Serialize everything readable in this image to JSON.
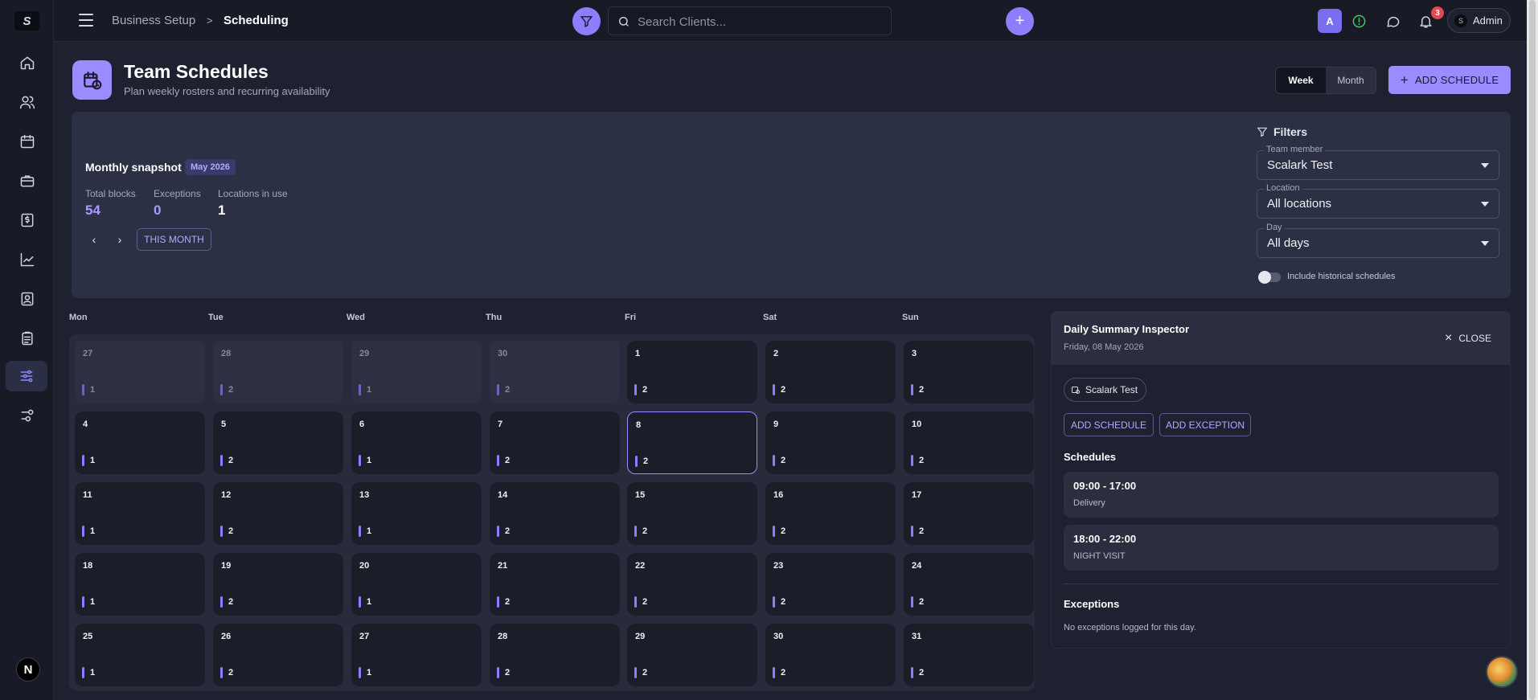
{
  "logo": {
    "text": "S"
  },
  "sidebar": {
    "items": [
      {
        "icon": "home-icon"
      },
      {
        "icon": "users-icon"
      },
      {
        "icon": "calendar-icon"
      },
      {
        "icon": "briefcase-icon"
      },
      {
        "icon": "invoice-icon"
      },
      {
        "icon": "chart-icon"
      },
      {
        "icon": "contact-card-icon"
      },
      {
        "icon": "clipboard-icon"
      },
      {
        "icon": "sliders-icon",
        "active": true
      },
      {
        "icon": "settings-toggle-icon"
      }
    ],
    "bottom_label": "N"
  },
  "topbar": {
    "breadcrumb": [
      "Business Setup",
      "Scheduling"
    ],
    "breadcrumb_sep": ">",
    "search_placeholder": "Search Clients...",
    "avatar_letter": "A",
    "notification_count": "3",
    "admin_label": "Admin",
    "accent": "#8e7dff"
  },
  "header": {
    "title": "Team Schedules",
    "subtitle": "Plan weekly rosters and recurring availability",
    "view_toggle": [
      "Week",
      "Month"
    ],
    "active_view": "Week",
    "add_button": "ADD SCHEDULE"
  },
  "snapshot": {
    "title": "Monthly snapshot",
    "month_chip": "May 2026",
    "stats": [
      {
        "label": "Total blocks",
        "value": "54",
        "color": "#a99cff"
      },
      {
        "label": "Exceptions",
        "value": "0",
        "color": "#a99cff"
      },
      {
        "label": "Locations in use",
        "value": "1",
        "color": "#ffffff"
      }
    ],
    "prev": "‹",
    "next": "›",
    "this_month": "THIS MONTH"
  },
  "filters": {
    "title": "Filters",
    "team_member": {
      "label": "Team member",
      "value": "Scalark Test"
    },
    "location": {
      "label": "Location",
      "value": "All locations"
    },
    "day": {
      "label": "Day",
      "value": "All days"
    },
    "historical_label": "Include historical schedules"
  },
  "calendar": {
    "weekdays": [
      "Mon",
      "Tue",
      "Wed",
      "Thu",
      "Fri",
      "Sat",
      "Sun"
    ],
    "weeks": [
      [
        {
          "d": "27",
          "c": "1",
          "m": true
        },
        {
          "d": "28",
          "c": "2",
          "m": true
        },
        {
          "d": "29",
          "c": "1",
          "m": true
        },
        {
          "d": "30",
          "c": "2",
          "m": true
        },
        {
          "d": "1",
          "c": "2"
        },
        {
          "d": "2",
          "c": "2"
        },
        {
          "d": "3",
          "c": "2"
        }
      ],
      [
        {
          "d": "4",
          "c": "1"
        },
        {
          "d": "5",
          "c": "2"
        },
        {
          "d": "6",
          "c": "1"
        },
        {
          "d": "7",
          "c": "2"
        },
        {
          "d": "8",
          "c": "2",
          "sel": true
        },
        {
          "d": "9",
          "c": "2"
        },
        {
          "d": "10",
          "c": "2"
        }
      ],
      [
        {
          "d": "11",
          "c": "1"
        },
        {
          "d": "12",
          "c": "2"
        },
        {
          "d": "13",
          "c": "1"
        },
        {
          "d": "14",
          "c": "2"
        },
        {
          "d": "15",
          "c": "2"
        },
        {
          "d": "16",
          "c": "2"
        },
        {
          "d": "17",
          "c": "2"
        }
      ],
      [
        {
          "d": "18",
          "c": "1"
        },
        {
          "d": "19",
          "c": "2"
        },
        {
          "d": "20",
          "c": "1"
        },
        {
          "d": "21",
          "c": "2"
        },
        {
          "d": "22",
          "c": "2"
        },
        {
          "d": "23",
          "c": "2"
        },
        {
          "d": "24",
          "c": "2"
        }
      ],
      [
        {
          "d": "25",
          "c": "1"
        },
        {
          "d": "26",
          "c": "2"
        },
        {
          "d": "27",
          "c": "1"
        },
        {
          "d": "28",
          "c": "2"
        },
        {
          "d": "29",
          "c": "2"
        },
        {
          "d": "30",
          "c": "2"
        },
        {
          "d": "31",
          "c": "2"
        }
      ]
    ]
  },
  "inspector": {
    "title": "Daily Summary Inspector",
    "date": "Friday, 08 May 2026",
    "close_label": "CLOSE",
    "member_chip": "Scalark Test",
    "add_schedule": "ADD SCHEDULE",
    "add_exception": "ADD EXCEPTION",
    "schedules_title": "Schedules",
    "schedules": [
      {
        "time": "09:00 - 17:00",
        "label": "Delivery"
      },
      {
        "time": "18:00 - 22:00",
        "label": "NIGHT VISIT"
      }
    ],
    "exceptions_title": "Exceptions",
    "exceptions_empty": "No exceptions logged for this day."
  }
}
